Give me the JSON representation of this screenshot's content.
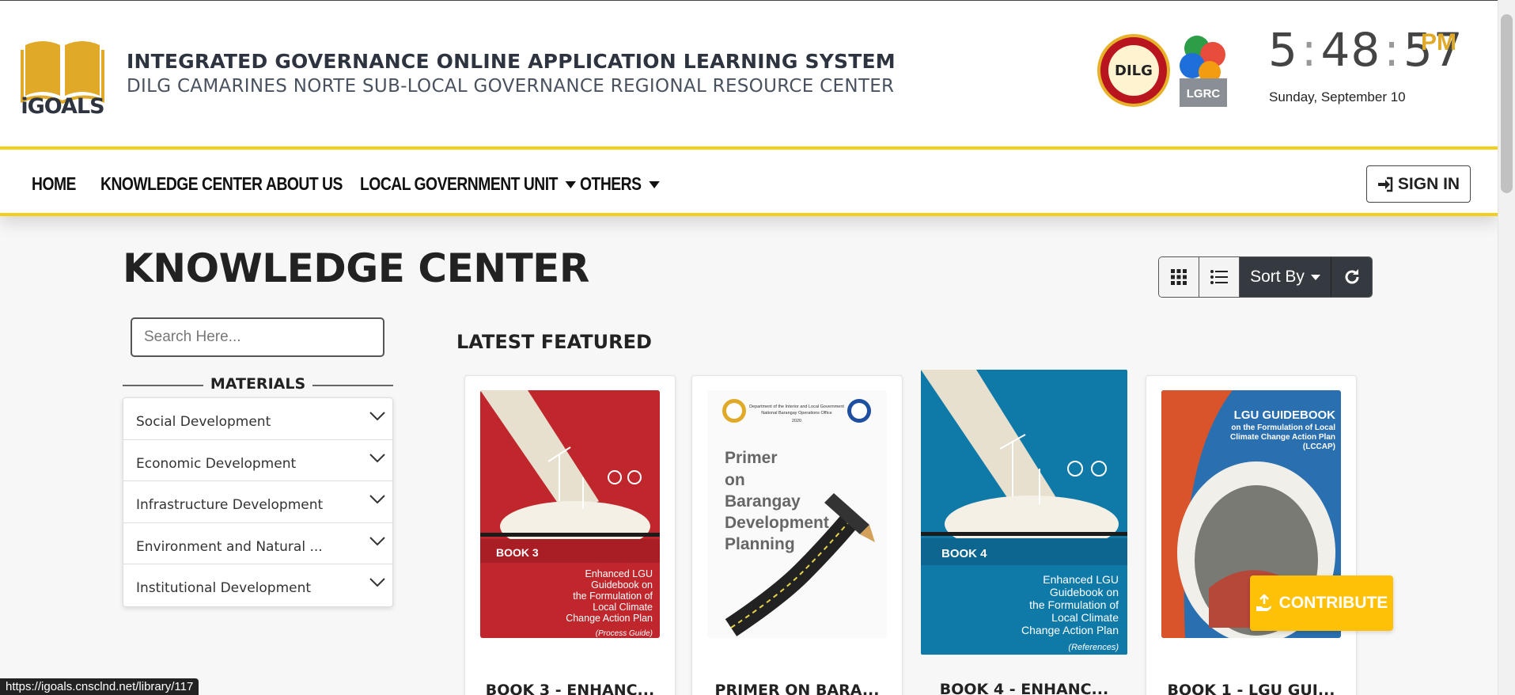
{
  "header": {
    "logo_text": "iGOALS",
    "title": "INTEGRATED GOVERNANCE ONLINE APPLICATION LEARNING SYSTEM",
    "subtitle": "DILG CAMARINES NORTE SUB-LOCAL GOVERNANCE REGIONAL RESOURCE CENTER",
    "dilg_label": "DILG",
    "lgrc_label": "LGRC",
    "clock": {
      "h": "5",
      "m": "48",
      "s": "57",
      "ampm": "PM"
    },
    "date": "Sunday, September 10"
  },
  "nav": {
    "items": [
      "HOME",
      "KNOWLEDGE CENTER",
      "ABOUT US",
      "LOCAL GOVERNMENT UNIT",
      "OTHERS"
    ],
    "signin": "SIGN IN"
  },
  "main": {
    "title": "KNOWLEDGE CENTER",
    "sort_label": "Sort By",
    "search_placeholder": "Search Here...",
    "materials_label": "MATERIALS",
    "categories": [
      "Social Development",
      "Economic Development",
      "Infrastructure Development",
      "Environment and Natural ...",
      "Institutional Development"
    ],
    "latest_label": "LATEST FEATURED",
    "cards": [
      {
        "caption": "BOOK 3 - ENHANC...",
        "book": "BOOK 3",
        "cover_lines": [
          "Enhanced LGU",
          "Guidebook on",
          "the Formulation of",
          "Local Climate",
          "Change Action Plan"
        ],
        "tag": "(Process Guide)"
      },
      {
        "caption": "PRIMER ON BARA...",
        "cover_lines": [
          "Primer",
          "on",
          "Barangay",
          "Development",
          "Planning"
        ],
        "head": [
          "Department of the Interior and Local Government",
          "National Barangay Operations Office",
          "2020"
        ]
      },
      {
        "caption": "BOOK 4 - ENHANC...",
        "book": "BOOK 4",
        "cover_lines": [
          "Enhanced LGU",
          "Guidebook on",
          "the Formulation of",
          "Local Climate",
          "Change Action Plan"
        ],
        "tag": "(References)"
      },
      {
        "caption": "BOOK 1 - LGU GUI...",
        "cover_lines": [
          "LGU GUIDEBOOK",
          "on the Formulation of Local",
          "Climate Change Action Plan",
          "(LCCAP)"
        ]
      }
    ],
    "contribute": "CONTRIBUTE"
  },
  "status_url": "https://igoals.cnsclnd.net/library/117",
  "colors": {
    "accent_yellow": "#f2cf1b",
    "gold": "#e0a928",
    "dark": "#343a40",
    "contribute": "#ffc107"
  }
}
